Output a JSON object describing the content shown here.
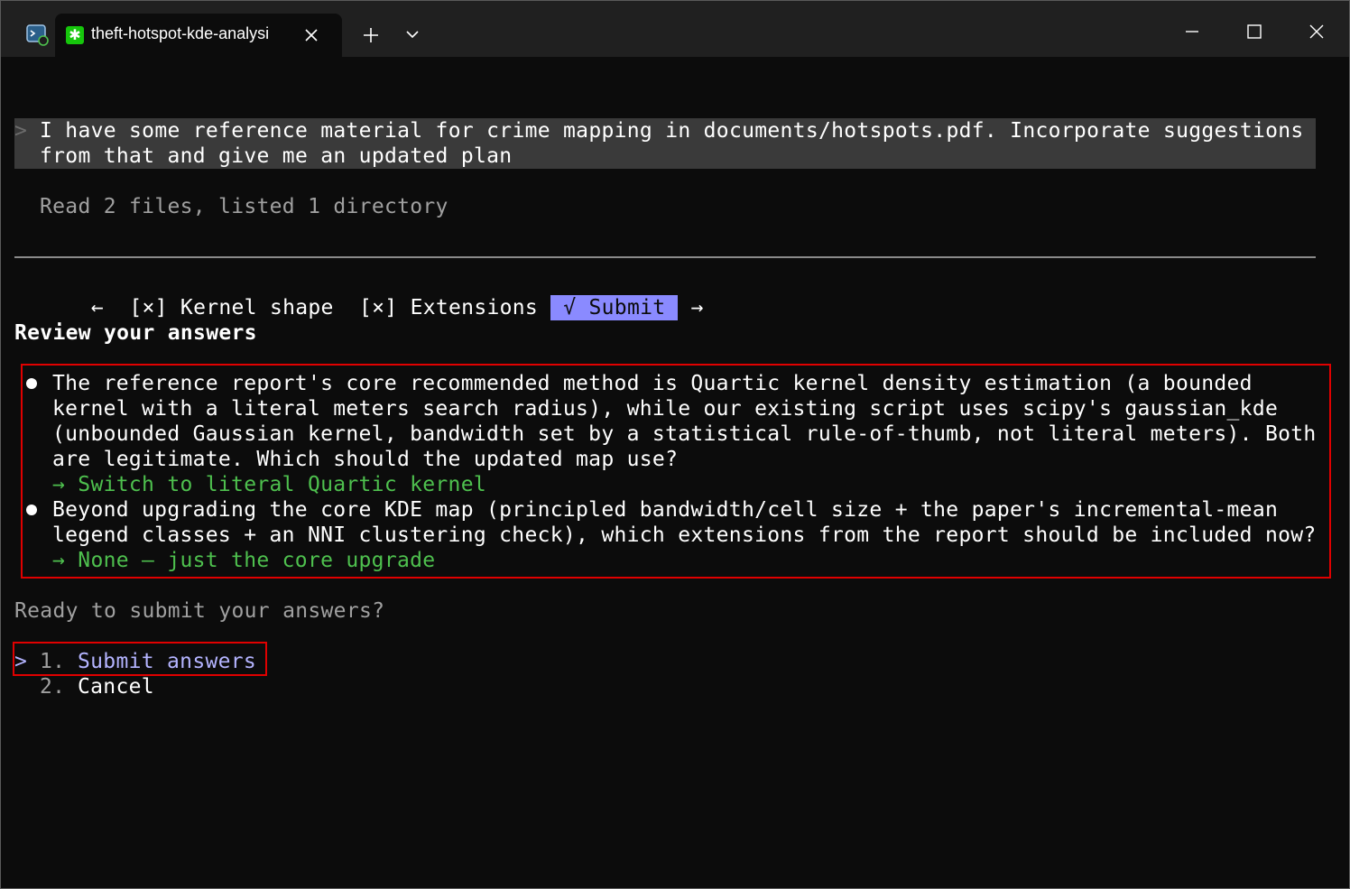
{
  "window": {
    "tab_title": "theft-hotspot-kde-analysi",
    "icons": {
      "app": "terminal-app-icon",
      "tab": "asterisk-icon",
      "tab_close": "close-icon",
      "new_tab": "plus-icon",
      "dropdown": "chevron-down-icon",
      "minimize": "minimize-icon",
      "maximize": "maximize-icon",
      "close": "close-icon"
    }
  },
  "terminal": {
    "prompt_caret": ">",
    "prompt_line1": "I have some reference material for crime mapping in documents/hotspots.pdf. Incorporate suggestions",
    "prompt_line2": "from that and give me an updated plan",
    "status_line": "Read 2 files, listed 1 directory",
    "nav": {
      "left_arrow": "←",
      "item1": "[×] Kernel shape",
      "item2": "[×] Extensions",
      "submit": "√ Submit",
      "right_arrow": "→"
    },
    "review_heading": "Review your answers",
    "answers": [
      {
        "question_lines": [
          "The reference report's core recommended method is Quartic kernel density estimation (a bounded",
          "kernel with a literal meters search radius), while our existing script uses scipy's gaussian_kde",
          "(unbounded Gaussian kernel, bandwidth set by a statistical rule-of-thumb, not literal meters). Both",
          "are legitimate. Which should the updated map use?"
        ],
        "answer": "→ Switch to literal Quartic kernel"
      },
      {
        "question_lines": [
          "Beyond upgrading the core KDE map (principled bandwidth/cell size + the paper's incremental-mean",
          "legend classes + an NNI clustering check), which extensions from the report should be included now?"
        ],
        "answer": "→ None — just the core upgrade"
      }
    ],
    "ready_prompt": "Ready to submit your answers?",
    "options": {
      "selector": ">",
      "option1_num": "1.",
      "option1_label": "Submit answers",
      "option2_num": "2.",
      "option2_label": "Cancel"
    }
  },
  "colors": {
    "background": "#0c0c0c",
    "titlebar": "#202020",
    "prompt_bg": "#3a3a3a",
    "accent_purple": "#8a8aff",
    "answer_green": "#4ec04e",
    "highlight_red": "#e00000"
  }
}
